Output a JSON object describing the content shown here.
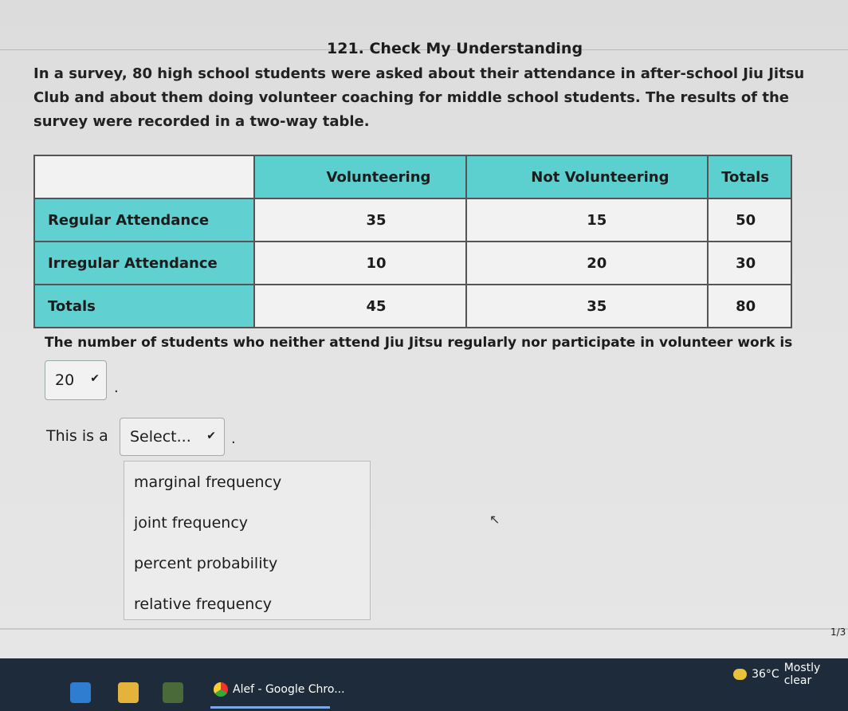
{
  "title": "121. Check My Understanding",
  "intro": "In a survey, 80 high school students were asked about their attendance in after-school Jiu Jitsu Club and about them doing volunteer coaching for middle school students. The results of the survey were recorded in a two-way table.",
  "table": {
    "headers": [
      "",
      "Volunteering",
      "Not Volunteering",
      "Totals"
    ],
    "rows": [
      {
        "label": "Regular Attendance",
        "values": [
          "35",
          "15",
          "50"
        ]
      },
      {
        "label": "Irregular Attendance",
        "values": [
          "10",
          "20",
          "30"
        ]
      },
      {
        "label": "Totals",
        "values": [
          "45",
          "35",
          "80"
        ]
      }
    ]
  },
  "question": "The number of students who neither attend Jiu Jitsu regularly nor participate in volunteer work is",
  "answer1": "20",
  "period": ".",
  "this_is": "This is a",
  "select_placeholder": "Select...",
  "dropdown_options": [
    "marginal frequency",
    "joint frequency",
    "percent probability",
    "relative frequency"
  ],
  "page_number": "1/3",
  "taskbar": {
    "weather_temp": "36°C",
    "weather_desc": "Mostly clear",
    "chrome_label": "Alef - Google Chro..."
  }
}
